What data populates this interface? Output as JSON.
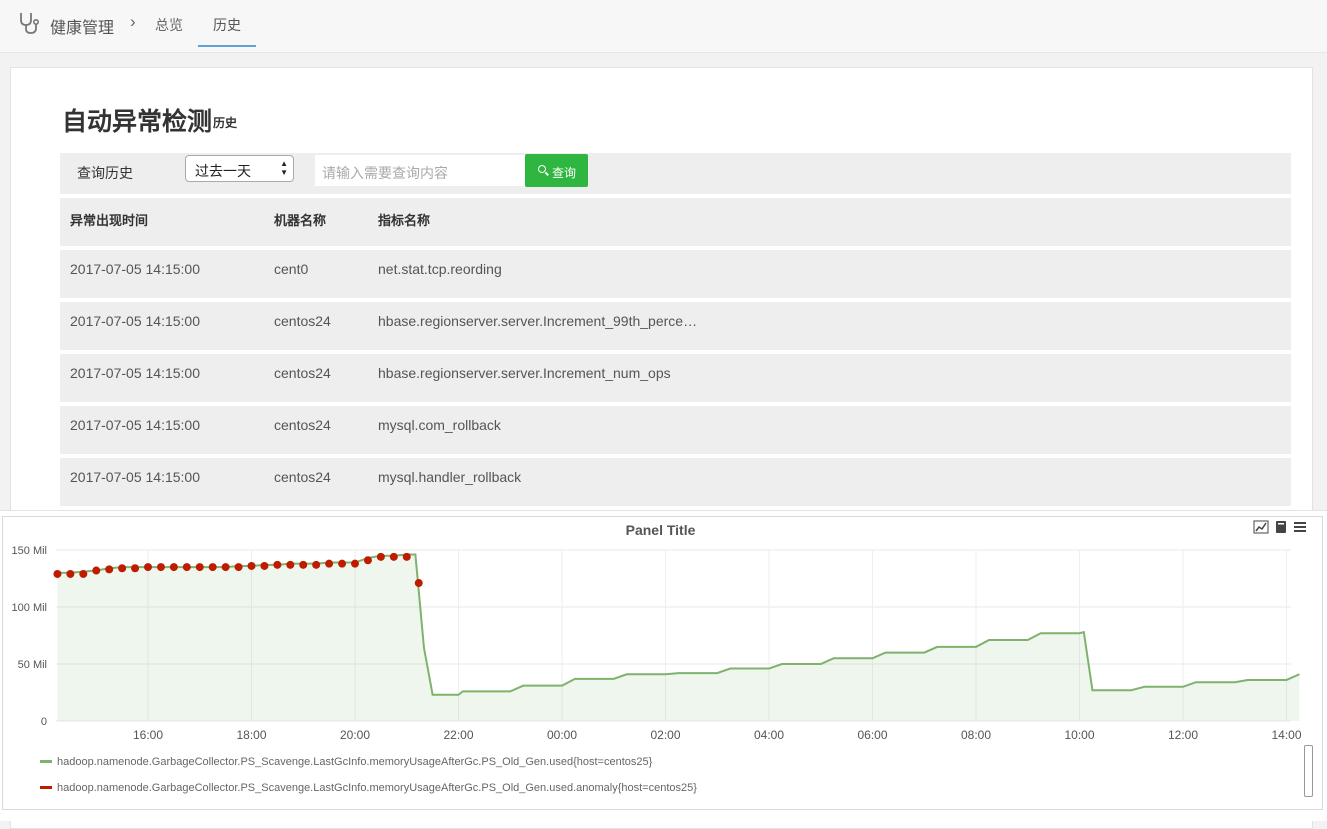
{
  "nav": {
    "brand_icon": "stethoscope-icon",
    "title": "健康管理",
    "separator": "›",
    "tabs": [
      {
        "label": "总览",
        "active": false
      },
      {
        "label": "历史",
        "active": true
      }
    ],
    "accent": "#5ea2d8"
  },
  "page": {
    "title": "自动异常检测",
    "subtitle": "历史"
  },
  "filter": {
    "label": "查询历史",
    "range_selected": "过去一天",
    "search_placeholder": "请输入需要查询内容",
    "query_button": "查询",
    "query_icon": "search-icon",
    "button_color": "#2eb640"
  },
  "table": {
    "headers": [
      "异常出现时间",
      "机器名称",
      "指标名称"
    ],
    "rows": [
      [
        "2017-07-05 14:15:00",
        "cent0",
        "net.stat.tcp.reording"
      ],
      [
        "2017-07-05 14:15:00",
        "centos24",
        "hbase.regionserver.server.Increment_99th_perce…"
      ],
      [
        "2017-07-05 14:15:00",
        "centos24",
        "hbase.regionserver.server.Increment_num_ops"
      ],
      [
        "2017-07-05 14:15:00",
        "centos24",
        "mysql.com_rollback"
      ],
      [
        "2017-07-05 14:15:00",
        "centos24",
        "mysql.handler_rollback"
      ]
    ]
  },
  "panel": {
    "title": "Panel Title",
    "tool_icons": [
      "line-chart-icon",
      "book-icon",
      "menu-icon"
    ]
  },
  "chart_data": {
    "type": "line",
    "title": "Panel Title",
    "xlabel": "",
    "ylabel": "",
    "x_ticks": [
      "16:00",
      "18:00",
      "20:00",
      "22:00",
      "00:00",
      "02:00",
      "04:00",
      "06:00",
      "08:00",
      "10:00",
      "12:00",
      "14:00"
    ],
    "y_ticks": [
      "0",
      "50 Mil",
      "100 Mil",
      "150 Mil"
    ],
    "ylim": [
      0,
      150
    ],
    "y_unit": "Mil",
    "grid": true,
    "legend_position": "bottom",
    "series": [
      {
        "name": "hadoop.namenode.GarbageCollector.PS_Scavenge.LastGcInfo.memoryUsageAfterGc.PS_Old_Gen.used{host=centos25}",
        "color": "#7eb26d",
        "style": "line-area",
        "x": [
          "14:15",
          "14:30",
          "14:45",
          "15:00",
          "15:15",
          "15:30",
          "15:45",
          "16:00",
          "16:15",
          "16:30",
          "16:45",
          "17:00",
          "17:15",
          "17:30",
          "17:45",
          "18:00",
          "18:15",
          "18:30",
          "18:45",
          "19:00",
          "19:15",
          "19:30",
          "19:45",
          "20:00",
          "20:15",
          "20:30",
          "20:45",
          "21:00",
          "21:10",
          "21:20",
          "21:30",
          "22:00",
          "22:05",
          "23:00",
          "23:15",
          "00:00",
          "00:15",
          "01:00",
          "01:15",
          "02:00",
          "02:15",
          "03:00",
          "03:15",
          "04:00",
          "04:15",
          "05:00",
          "05:15",
          "06:00",
          "06:15",
          "07:00",
          "07:15",
          "08:00",
          "08:15",
          "09:00",
          "09:15",
          "10:00",
          "10:05",
          "10:15",
          "11:00",
          "11:15",
          "12:00",
          "12:15",
          "13:00",
          "13:15",
          "14:00",
          "14:15"
        ],
        "y": [
          130,
          130,
          131,
          132,
          134,
          135,
          135,
          135,
          135,
          135,
          135,
          135,
          135,
          135,
          136,
          136,
          137,
          137,
          138,
          138,
          138,
          139,
          139,
          139,
          143,
          145,
          145,
          146,
          146,
          64,
          23,
          23,
          26,
          26,
          31,
          31,
          37,
          37,
          41,
          41,
          42,
          42,
          46,
          46,
          50,
          50,
          55,
          55,
          60,
          60,
          65,
          65,
          71,
          71,
          77,
          77,
          78,
          27,
          27,
          30,
          30,
          34,
          34,
          36,
          36,
          41
        ]
      },
      {
        "name": "hadoop.namenode.GarbageCollector.PS_Scavenge.LastGcInfo.memoryUsageAfterGc.PS_Old_Gen.used.anomaly{host=centos25}",
        "color": "#bf1b00",
        "style": "points",
        "x": [
          "14:15",
          "14:30",
          "14:45",
          "15:00",
          "15:15",
          "15:30",
          "15:45",
          "16:00",
          "16:15",
          "16:30",
          "16:45",
          "17:00",
          "17:15",
          "17:30",
          "17:45",
          "18:00",
          "18:15",
          "18:30",
          "18:45",
          "19:00",
          "19:15",
          "19:30",
          "19:45",
          "20:00",
          "20:15",
          "20:30",
          "20:45",
          "21:00"
        ],
        "y": [
          129,
          129,
          129,
          132,
          133,
          134,
          134,
          135,
          135,
          135,
          135,
          135,
          135,
          135,
          135,
          136,
          136,
          137,
          137,
          137,
          137,
          138,
          138,
          138,
          141,
          144,
          144,
          144
        ],
        "extra_points": [
          {
            "x": "21:00",
            "y": 121
          }
        ]
      }
    ]
  }
}
